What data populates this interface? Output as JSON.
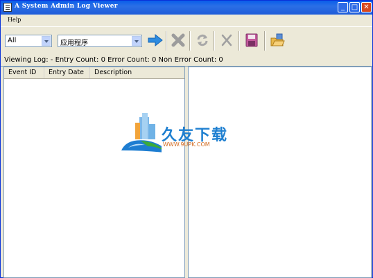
{
  "window": {
    "title": "A System Admin Log Viewer",
    "controls": {
      "minimize": "_",
      "maximize": "□",
      "close": "✕"
    }
  },
  "menu": {
    "items": [
      "Help"
    ]
  },
  "toolbar": {
    "log_filter": {
      "selected": "All"
    },
    "log_source": {
      "selected": "应用程序"
    },
    "icons": [
      "arrow-right-icon",
      "delete-x-icon",
      "refresh-icon",
      "cancel-icon",
      "save-disk-icon",
      "open-folder-icon"
    ]
  },
  "status": {
    "text": "Viewing Log:  - Entry Count: 0 Error Count: 0 Non Error Count: 0"
  },
  "table": {
    "columns": [
      "Event ID",
      "Entry Date",
      "Description"
    ],
    "rows": []
  },
  "watermark": {
    "title": "久友下载",
    "url": "WWW.9UPK.COM"
  },
  "colors": {
    "titlebar": "#0A5EEA",
    "accent": "#2D8BE0",
    "background": "#ECE9D8"
  }
}
